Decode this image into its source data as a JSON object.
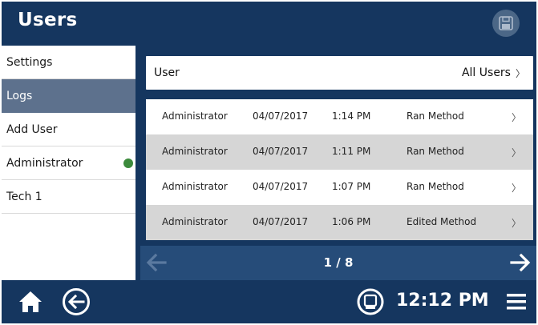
{
  "header": {
    "title": "Users",
    "save_icon": "save-icon"
  },
  "sidebar": {
    "items": [
      {
        "label": "Settings"
      },
      {
        "label": "Logs"
      },
      {
        "label": "Add User"
      },
      {
        "label": "Administrator",
        "status_color": "#3c8a3c"
      },
      {
        "label": "Tech 1"
      }
    ]
  },
  "filter": {
    "label": "User",
    "value": "All Users",
    "chevron": "〉"
  },
  "logs": {
    "rows": [
      {
        "user": "Administrator",
        "date": "04/07/2017",
        "time": "1:14 PM",
        "action": "Ran Method",
        "chevron": "〉"
      },
      {
        "user": "Administrator",
        "date": "04/07/2017",
        "time": "1:11 PM",
        "action": "Ran Method",
        "chevron": "〉"
      },
      {
        "user": "Administrator",
        "date": "04/07/2017",
        "time": "1:07 PM",
        "action": "Ran Method",
        "chevron": "〉"
      },
      {
        "user": "Administrator",
        "date": "04/07/2017",
        "time": "1:06 PM",
        "action": "Edited Method",
        "chevron": "〉"
      }
    ]
  },
  "pager": {
    "indicator": "1 / 8",
    "prev_icon": "arrow-left-icon",
    "next_icon": "arrow-right-icon"
  },
  "footer": {
    "time": "12:12 PM",
    "home_icon": "home-icon",
    "back_icon": "back-circle-icon",
    "device_icon": "device-icon",
    "menu_icon": "hamburger-menu-icon"
  },
  "colors": {
    "navy": "#15365f",
    "active_item": "#5d718d",
    "pager_bar": "#264c79",
    "alt_row": "#d6d6d6"
  }
}
